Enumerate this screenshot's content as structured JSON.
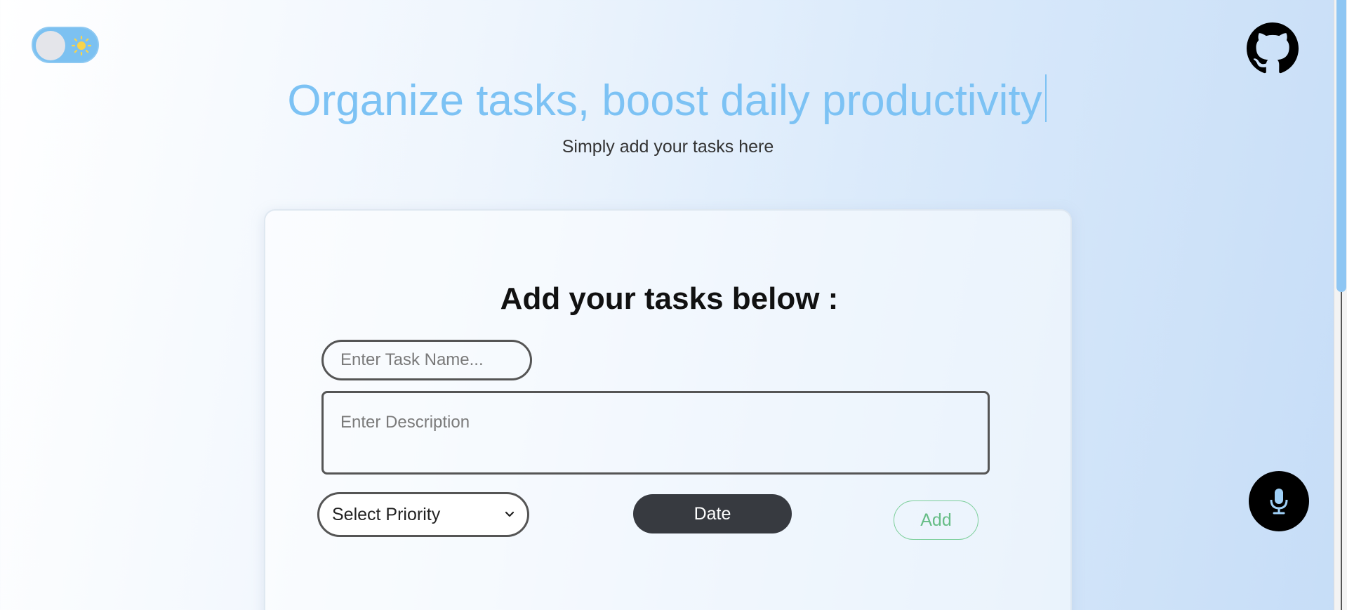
{
  "theme_toggle": {
    "state": "light",
    "icon": "sun-icon",
    "sun_color": "#f9d44a"
  },
  "header": {
    "title": "Organize tasks, boost daily productivity",
    "subtitle": "Simply add your tasks here",
    "title_color": "#7cc2f4"
  },
  "form": {
    "title": "Add your tasks below :",
    "task_name": {
      "value": "",
      "placeholder": "Enter Task Name..."
    },
    "description": {
      "value": "",
      "placeholder": "Enter Description"
    },
    "priority": {
      "selected": "Select Priority"
    },
    "date_label": "Date",
    "add_label": "Add",
    "add_color": "#66bd86"
  },
  "icons": {
    "github": "github-icon",
    "mic": "microphone-icon"
  }
}
